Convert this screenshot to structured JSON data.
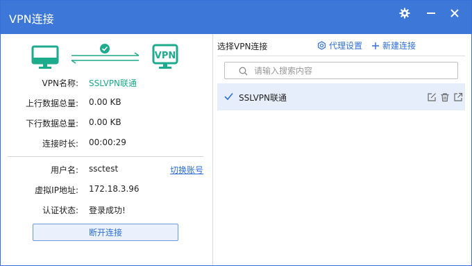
{
  "window": {
    "title": "VPN连接"
  },
  "status": {
    "vpn_name_label": "VPN名称:",
    "vpn_name_value": "SSLVPN联通",
    "upload_label": "上行数据总量:",
    "upload_value": "0.00 KB",
    "download_label": "下行数据总量:",
    "download_value": "0.00 KB",
    "duration_label": "连接时长:",
    "duration_value": "00:00:29",
    "hero_right_text": "VPN"
  },
  "account": {
    "user_label": "用户名:",
    "user_value": "ssctest",
    "switch_link": "切换账号",
    "ip_label": "虚拟IP地址:",
    "ip_value": "172.18.3.96",
    "auth_label": "认证状态:",
    "auth_value": "登录成功!"
  },
  "disconnect_label": "断开连接",
  "right": {
    "title": "选择VPN连接",
    "proxy_label": "代理设置",
    "new_label": "新建连接",
    "search_placeholder": "请输入搜索内容",
    "search_value": "",
    "items": [
      {
        "name": "SSLVPN联通",
        "selected": true
      }
    ]
  },
  "colors": {
    "titlebar": "#3d78d8",
    "accent": "#2f6fd6",
    "green": "#1eaa8c",
    "selected_row": "#e7eefb"
  },
  "icons": [
    "gear-icon",
    "minimize-icon",
    "close-icon",
    "monitor-icon",
    "check-circle-icon",
    "vpn-monitor-icon",
    "settings-icon",
    "plus-icon",
    "search-icon",
    "checkmark-icon",
    "edit-icon",
    "trash-icon",
    "external-link-icon"
  ]
}
